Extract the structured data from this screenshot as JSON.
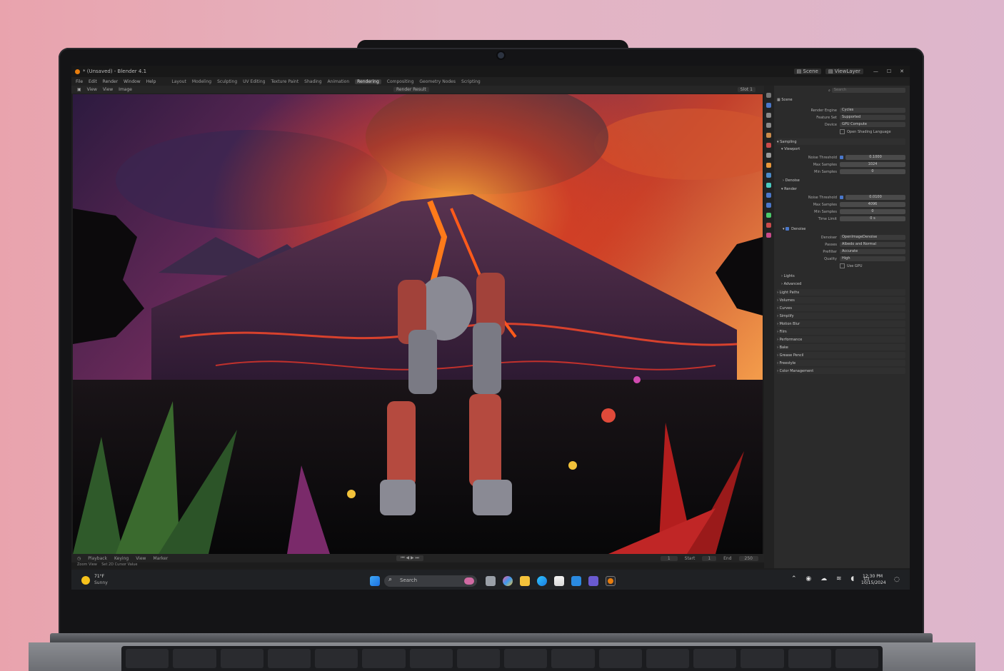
{
  "app": {
    "title": "* (Unsaved) - Blender 4.1",
    "menu": [
      "File",
      "Edit",
      "Render",
      "Window",
      "Help"
    ],
    "workspaces": [
      {
        "label": "Layout",
        "active": false
      },
      {
        "label": "Modeling",
        "active": false
      },
      {
        "label": "Sculpting",
        "active": false
      },
      {
        "label": "UV Editing",
        "active": false
      },
      {
        "label": "Texture Paint",
        "active": false
      },
      {
        "label": "Shading",
        "active": false
      },
      {
        "label": "Animation",
        "active": false
      },
      {
        "label": "Rendering",
        "active": true
      },
      {
        "label": "Compositing",
        "active": false
      },
      {
        "label": "Geometry Nodes",
        "active": false
      },
      {
        "label": "Scripting",
        "active": false
      }
    ],
    "scene_label": "Scene",
    "view_layer_label": "ViewLayer",
    "viewport_menu": [
      "View",
      "View",
      "Image"
    ],
    "render_result_label": "Render Result",
    "slot_label": "Slot 1",
    "timeline_menu": [
      "Playback",
      "Keying",
      "View",
      "Marker"
    ],
    "timeline_values": {
      "current": "1",
      "start_label": "Start",
      "start": "1",
      "end_label": "End",
      "end": "250"
    },
    "status_items": [
      "Zoom View",
      "Set 2D Cursor Value"
    ]
  },
  "properties": {
    "search_placeholder": "Search",
    "scene_name": "Scene",
    "rows_top": [
      {
        "label": "Render Engine",
        "value": "Cycles"
      },
      {
        "label": "Feature Set",
        "value": "Supported"
      },
      {
        "label": "Device",
        "value": "GPU Compute"
      }
    ],
    "osl_label": "Open Shading Language",
    "sampling_label": "Sampling",
    "viewport_label": "Viewport",
    "viewport_rows": [
      {
        "label": "Noise Threshold",
        "value": "0.1000"
      },
      {
        "label": "Max Samples",
        "value": "1024"
      },
      {
        "label": "Min Samples",
        "value": "0"
      }
    ],
    "denoise_label": "Denoise",
    "render_label": "Render",
    "render_rows": [
      {
        "label": "Noise Threshold",
        "value": "0.0100"
      },
      {
        "label": "Max Samples",
        "value": "4096"
      },
      {
        "label": "Min Samples",
        "value": "0"
      },
      {
        "label": "Time Limit",
        "value": "0 s"
      }
    ],
    "denoise_rows": [
      {
        "label": "Denoiser",
        "value": "OpenImageDenoise"
      },
      {
        "label": "Passes",
        "value": "Albedo and Normal"
      },
      {
        "label": "Prefilter",
        "value": "Accurate"
      },
      {
        "label": "Quality",
        "value": "High"
      }
    ],
    "use_gpu_label": "Use GPU",
    "subsections": [
      "Lights",
      "Advanced"
    ],
    "sections": [
      "Light Paths",
      "Volumes",
      "Curves",
      "Simplify",
      "Motion Blur",
      "Film",
      "Performance",
      "Bake",
      "Grease Pencil",
      "Freestyle",
      "Color Management"
    ]
  },
  "taskbar": {
    "weather_temp": "71°F",
    "weather_text": "Sunny",
    "search_placeholder": "Search",
    "time": "12:30 PM",
    "date": "10/15/2024"
  },
  "colors": {
    "accent": "#4a77c9",
    "viewport_bg": "#1d1d1d",
    "properties_bg": "#2b2b2b"
  }
}
